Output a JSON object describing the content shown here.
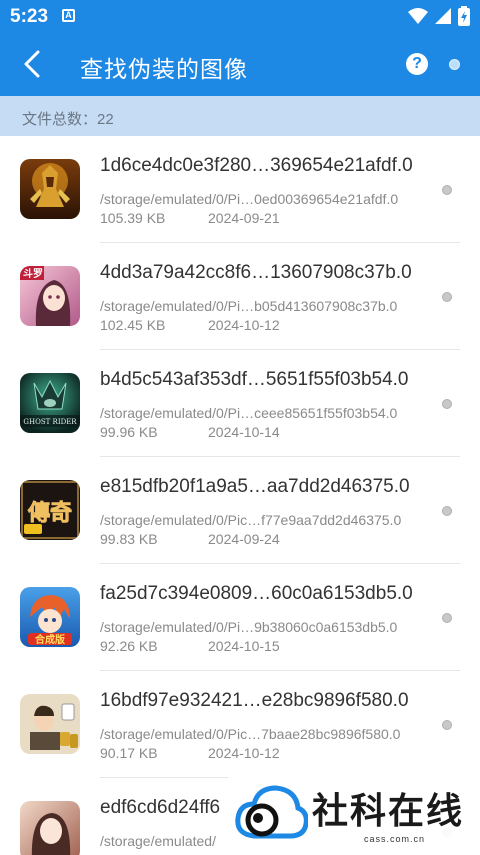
{
  "status_bar": {
    "time": "5:23",
    "notification_letter": "A"
  },
  "app_bar": {
    "title": "查找伪装的图像",
    "help_label": "?"
  },
  "summary": {
    "text": "文件总数：22"
  },
  "files": [
    {
      "name": "1d6ce4dc0e3f280…369654e21afdf.0",
      "path": "/storage/emulated/0/Pi…0ed00369654e21afdf.0",
      "size": "105.39 KB",
      "date": "2024-09-21",
      "thumb": "warrior-game-icon"
    },
    {
      "name": "4dd3a79a42cc8f6…13607908c37b.0",
      "path": "/storage/emulated/0/Pi…b05d413607908c37b.0",
      "size": "102.45 KB",
      "date": "2024-10-12",
      "thumb": "anime-girl-game-icon",
      "thumb_tag": "斗罗"
    },
    {
      "name": "b4d5c543af353df…5651f55f03b54.0",
      "path": "/storage/emulated/0/Pi…ceee85651f55f03b54.0",
      "size": "99.96 KB",
      "date": "2024-10-14",
      "thumb": "ghost-rider-game-icon",
      "thumb_tag": "GHOST RIDER"
    },
    {
      "name": "e815dfb20f1a9a5…aa7dd2d46375.0",
      "path": "/storage/emulated/0/Pic…f77e9aa7dd2d46375.0",
      "size": "99.83 KB",
      "date": "2024-09-24",
      "thumb": "legend-game-icon",
      "thumb_tag": "傳奇"
    },
    {
      "name": "fa25d7c394e0809…60c0a6153db5.0",
      "path": "/storage/emulated/0/Pi…9b38060c0a6153db5.0",
      "size": "92.26 KB",
      "date": "2024-10-15",
      "thumb": "anime-boy-game-icon",
      "thumb_tag": "合成版"
    },
    {
      "name": "16bdf97e932421…e28bc9896f580.0",
      "path": "/storage/emulated/0/Pic…7baae28bc9896f580.0",
      "size": "90.17 KB",
      "date": "2024-10-12",
      "thumb": "mahjong-game-icon"
    },
    {
      "name": "edf6cd6d24ff6",
      "path": "/storage/emulated/",
      "size": "",
      "date": "",
      "thumb": "heroine-game-icon"
    }
  ],
  "watermark": {
    "brand": "社科在线",
    "url": "cass.com.cn"
  },
  "colors": {
    "primary": "#1E88E5",
    "summary_bg": "#C5DCF4",
    "text_primary": "#333333",
    "text_secondary": "#8a8a8a"
  }
}
